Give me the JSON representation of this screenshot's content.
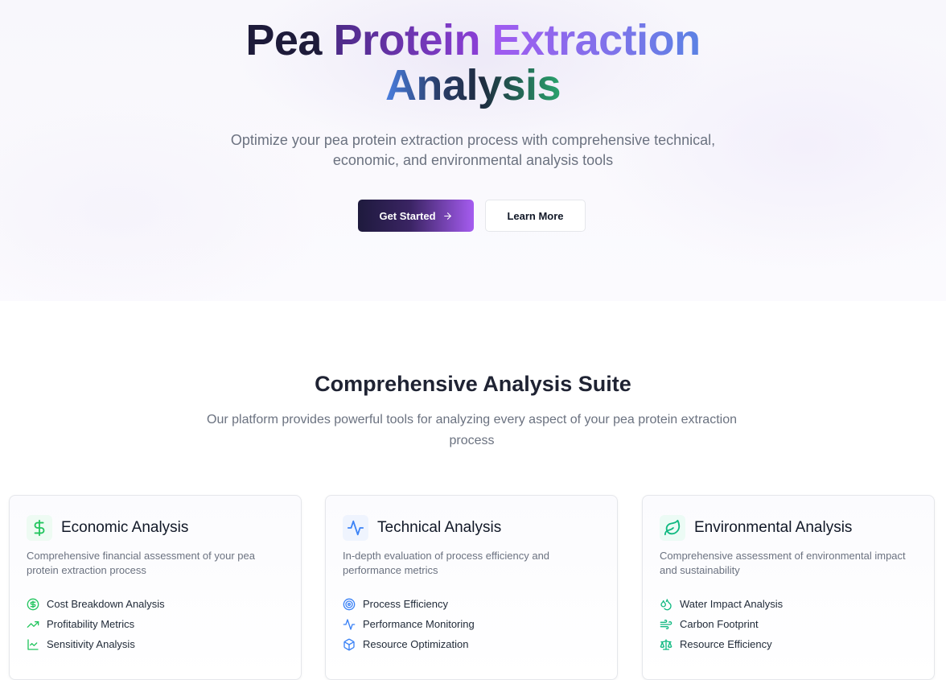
{
  "hero": {
    "title_word1": "Pea",
    "title_word2": "Protein",
    "title_word3": "Extraction",
    "title_word4": "Analysis",
    "subtitle": "Optimize your pea protein extraction process with comprehensive technical, economic, and environmental analysis tools",
    "primary_button": "Get Started",
    "secondary_button": "Learn More"
  },
  "features_section": {
    "title": "Comprehensive Analysis Suite",
    "subtitle": "Our platform provides powerful tools for analyzing every aspect of your pea protein extraction process"
  },
  "cards": [
    {
      "title": "Economic Analysis",
      "description": "Comprehensive financial assessment of your pea protein extraction process",
      "icon": "dollar-icon",
      "accent": "#22c55e",
      "features": [
        {
          "label": "Cost Breakdown Analysis",
          "icon": "dollar-circle-icon"
        },
        {
          "label": "Profitability Metrics",
          "icon": "trending-up-icon"
        },
        {
          "label": "Sensitivity Analysis",
          "icon": "line-chart-icon"
        }
      ]
    },
    {
      "title": "Technical Analysis",
      "description": "In-depth evaluation of process efficiency and performance metrics",
      "icon": "activity-icon",
      "accent": "#3b82f6",
      "features": [
        {
          "label": "Process Efficiency",
          "icon": "target-icon"
        },
        {
          "label": "Performance Monitoring",
          "icon": "activity-icon"
        },
        {
          "label": "Resource Optimization",
          "icon": "box-icon"
        }
      ]
    },
    {
      "title": "Environmental Analysis",
      "description": "Comprehensive assessment of environmental impact and sustainability",
      "icon": "leaf-icon",
      "accent": "#10b981",
      "features": [
        {
          "label": "Water Impact Analysis",
          "icon": "droplets-icon"
        },
        {
          "label": "Carbon Footprint",
          "icon": "wind-icon"
        },
        {
          "label": "Resource Efficiency",
          "icon": "scale-icon"
        }
      ]
    }
  ]
}
